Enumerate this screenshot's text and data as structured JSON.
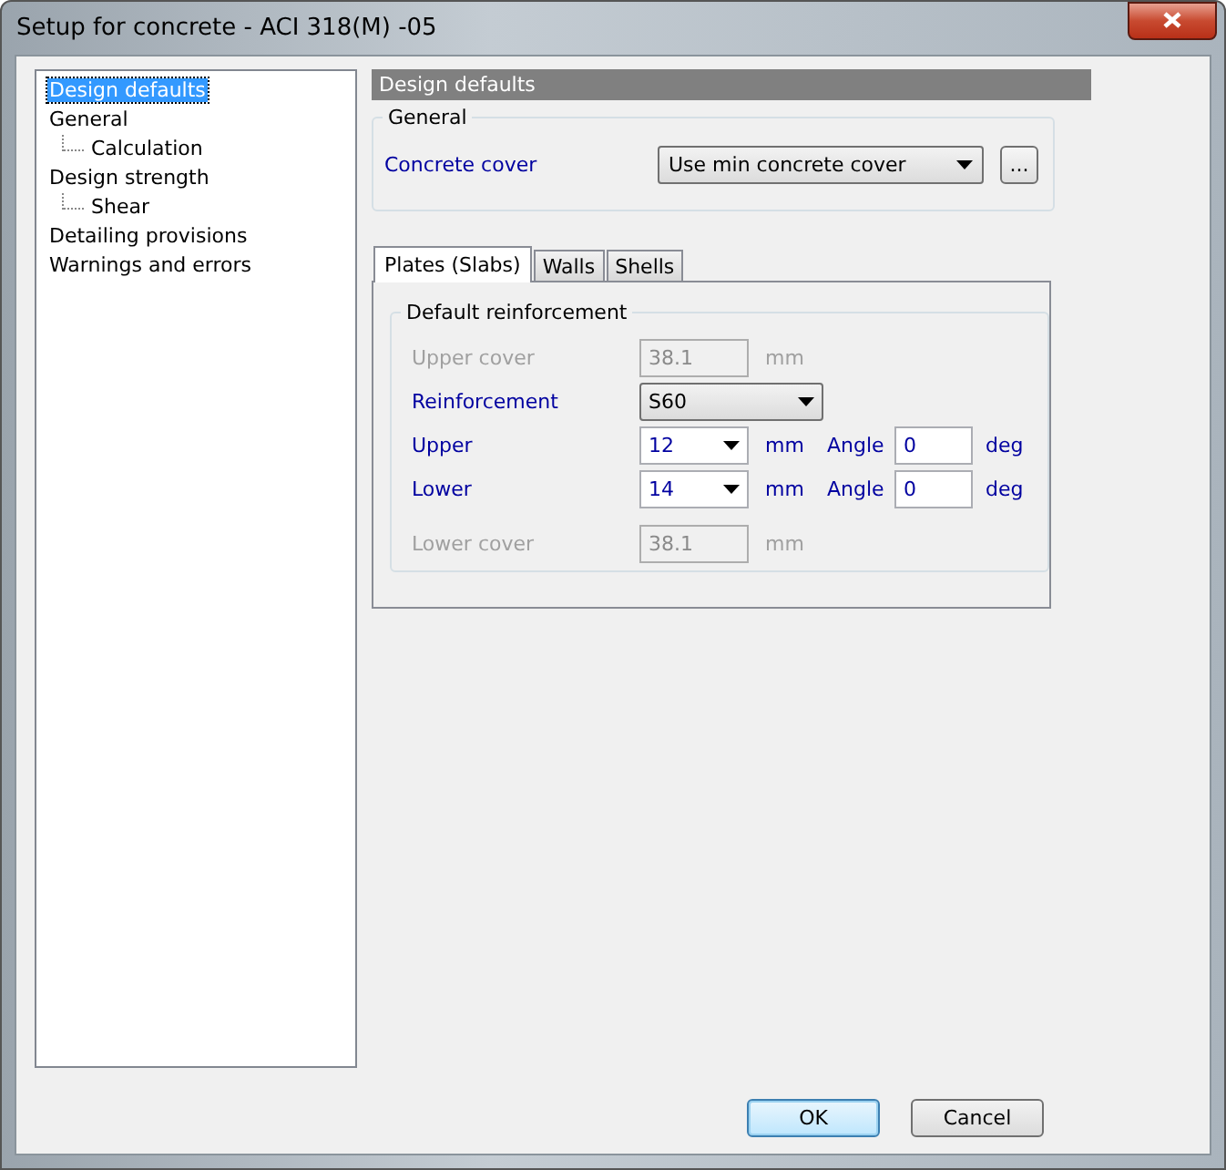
{
  "window": {
    "title": "Setup for concrete - ACI 318(M) -05"
  },
  "tree": [
    {
      "label": "Design defaults",
      "selected": true
    },
    {
      "label": "General",
      "selected": false,
      "children": [
        {
          "label": "Calculation",
          "selected": false
        }
      ]
    },
    {
      "label": "Design strength",
      "selected": false,
      "children": [
        {
          "label": "Shear",
          "selected": false
        }
      ]
    },
    {
      "label": "Detailing provisions",
      "selected": false
    },
    {
      "label": "Warnings and errors",
      "selected": false
    }
  ],
  "header": "Design defaults",
  "general": {
    "title": "General",
    "label": "Concrete cover",
    "value": "Use min concrete cover",
    "button": "..."
  },
  "tabs": [
    {
      "label": "Plates (Slabs)",
      "selected": true
    },
    {
      "label": "Walls",
      "selected": false
    },
    {
      "label": "Shells",
      "selected": false
    }
  ],
  "group": {
    "title": "Default reinforcement",
    "rows": [
      {
        "kind": "text",
        "label": "Upper cover",
        "value": "38.1",
        "unit": "mm",
        "disabled": true
      },
      {
        "kind": "select",
        "label": "Reinforcement",
        "value": "S60",
        "disabled": false
      },
      {
        "kind": "combo",
        "label": "Upper",
        "value": "12",
        "unit": "mm",
        "angle_label": "Angle",
        "angle_value": "0",
        "angle_unit": "deg",
        "disabled": false
      },
      {
        "kind": "combo",
        "label": "Lower",
        "value": "14",
        "unit": "mm",
        "angle_label": "Angle",
        "angle_value": "0",
        "angle_unit": "deg",
        "disabled": false
      },
      {
        "kind": "text",
        "label": "Lower cover",
        "value": "38.1",
        "unit": "mm",
        "disabled": true
      }
    ]
  },
  "buttons": [
    {
      "label": "OK",
      "default": true
    },
    {
      "label": "Cancel",
      "default": false
    }
  ]
}
